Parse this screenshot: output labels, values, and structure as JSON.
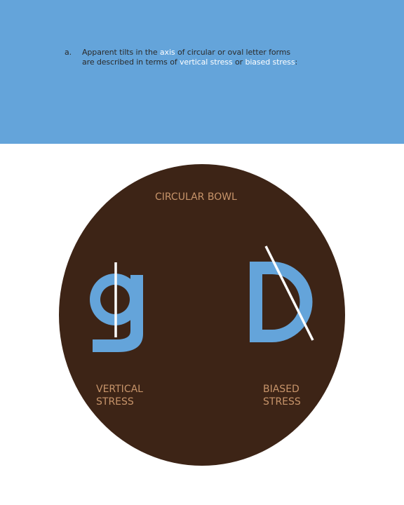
{
  "caption": {
    "marker": "a.",
    "line1_pre": "Apparent tilts in the ",
    "line1_hl": "axis",
    "line1_post": " of circular or oval letter forms",
    "line2_pre": "are described in terms of ",
    "line2_hl1": "vertical stress",
    "line2_mid": " or ",
    "line2_hl2": "biased stress",
    "line2_post": ":"
  },
  "diagram": {
    "title": "CIRCULAR BOWL",
    "left_label_1": "VERTICAL",
    "left_label_2": "STRESS",
    "right_label_1": "BIASED",
    "right_label_2": "STRESS",
    "left_letter": "g",
    "right_letter": "D"
  },
  "colors": {
    "band": "#64a4da",
    "circle": "#3d2416",
    "letter": "#64a4da",
    "label": "#c7946a",
    "axis_line": "#ffffff"
  }
}
